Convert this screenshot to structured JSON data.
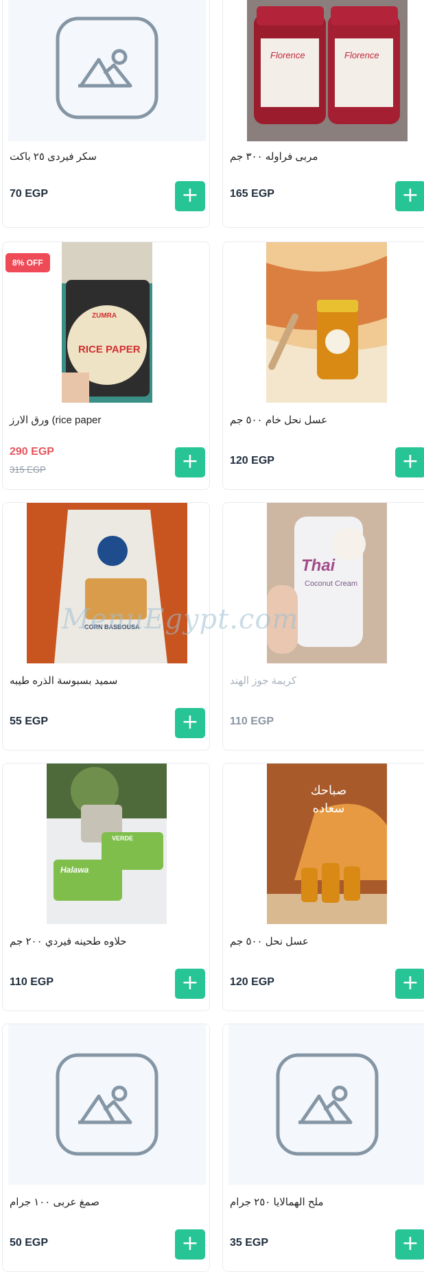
{
  "products": [
    {
      "name": "سكر فيردى ٢٥ باكت",
      "price": "70 EGP",
      "image": "placeholder-icon"
    },
    {
      "name": "مربى فراوله ٣٠٠ جم",
      "price": "165 EGP",
      "image": "strawberry-jam-jars-photo"
    },
    {
      "name": "ورق الارز (rice paper",
      "price": "290 EGP",
      "old_price": "315 EGP",
      "badge": "8% OFF",
      "image": "rice-paper-pack-photo"
    },
    {
      "name": "عسل نحل خام ٥٠٠ جم",
      "price": "120 EGP",
      "image": "honey-jar-photo"
    },
    {
      "name": "سميد بسبوسة الذره طيبه",
      "price": "55 EGP",
      "image": "corn-basbousa-bag-photo"
    },
    {
      "name": "كريمة جوز الهند",
      "price": "110 EGP",
      "image": "coconut-cream-can-photo"
    },
    {
      "name": "حلاوه طحينه فيردي ٢٠٠ جم",
      "price": "110 EGP",
      "image": "halawa-boxes-photo"
    },
    {
      "name": "عسل نحل ٥٠٠ جم",
      "price": "120 EGP",
      "image": "honey-jars-photo"
    },
    {
      "name": "صمغ عربى ١٠٠ جرام",
      "price": "50 EGP",
      "image": "placeholder-icon"
    },
    {
      "name": "ملح الهمالايا ٢٥٠ جرام",
      "price": "35 EGP",
      "image": "placeholder-icon"
    }
  ],
  "add_label": "+",
  "watermark": "MenuEgypt.com",
  "photo_text": {
    "jam_brand": "Florence",
    "rice_brand": "ZUMRA",
    "rice_label": "RICE PAPER",
    "corn_label": "CORN BASBOUSA",
    "coconut_brand": "Thai",
    "coconut_label": "Coconut Cream",
    "halawa_brand": "VERDE",
    "halawa_label": "Halawa",
    "wall_text": "صباحك سعاده"
  },
  "colors": {
    "accent": "#27c596",
    "sale": "#ef4a57"
  }
}
